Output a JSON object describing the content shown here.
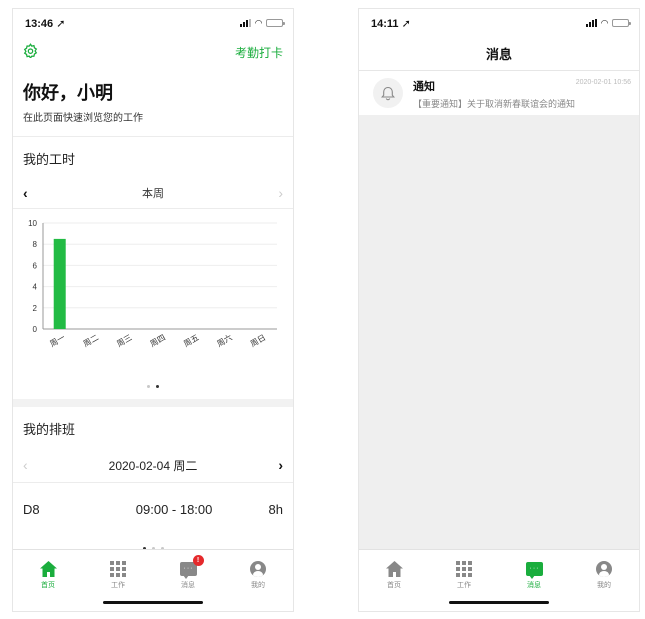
{
  "colors": {
    "accent": "#1aad3d",
    "bar": "#22bb44",
    "badge": "#e5292b",
    "background_gray": "#efefef"
  },
  "left": {
    "status": {
      "time": "13:46 ➚"
    },
    "header": {
      "gear_icon": "gear-icon",
      "clock_in": "考勤打卡"
    },
    "greeting": {
      "title": "你好，小明",
      "subtitle": "在此页面快速浏览您的工作"
    },
    "hours": {
      "section_title": "我的工时",
      "week_label": "本周",
      "prev": "‹",
      "next": "›"
    },
    "schedule": {
      "section_title": "我的排班",
      "date_label": "2020-02-04 周二",
      "prev": "‹",
      "next": "›",
      "shift_code": "D8",
      "shift_time": "09:00 - 18:00",
      "shift_hours": "8h"
    },
    "tabs": [
      {
        "label": "首页",
        "icon": "home-icon"
      },
      {
        "label": "工作",
        "icon": "grid-icon"
      },
      {
        "label": "消息",
        "icon": "message-icon",
        "badge": "!"
      },
      {
        "label": "我的",
        "icon": "user-icon"
      }
    ]
  },
  "right": {
    "status": {
      "time": "14:11 ➚"
    },
    "header": {
      "title": "消息"
    },
    "notification": {
      "title": "通知",
      "time": "2020-02-01 10:56",
      "preview": "【重要通知】关于取消新春联谊会的通知"
    },
    "tabs": [
      {
        "label": "首页",
        "icon": "home-icon"
      },
      {
        "label": "工作",
        "icon": "grid-icon"
      },
      {
        "label": "消息",
        "icon": "message-icon"
      },
      {
        "label": "我的",
        "icon": "user-icon"
      }
    ]
  },
  "chart_data": {
    "type": "bar",
    "categories": [
      "周一",
      "周二",
      "周三",
      "周四",
      "周五",
      "周六",
      "周日"
    ],
    "values": [
      8.5,
      0,
      0,
      0,
      0,
      0,
      0
    ],
    "title": "",
    "xlabel": "",
    "ylabel": "",
    "ylim": [
      0,
      10
    ],
    "yticks": [
      0,
      2,
      4,
      6,
      8,
      10
    ],
    "grid": true
  }
}
